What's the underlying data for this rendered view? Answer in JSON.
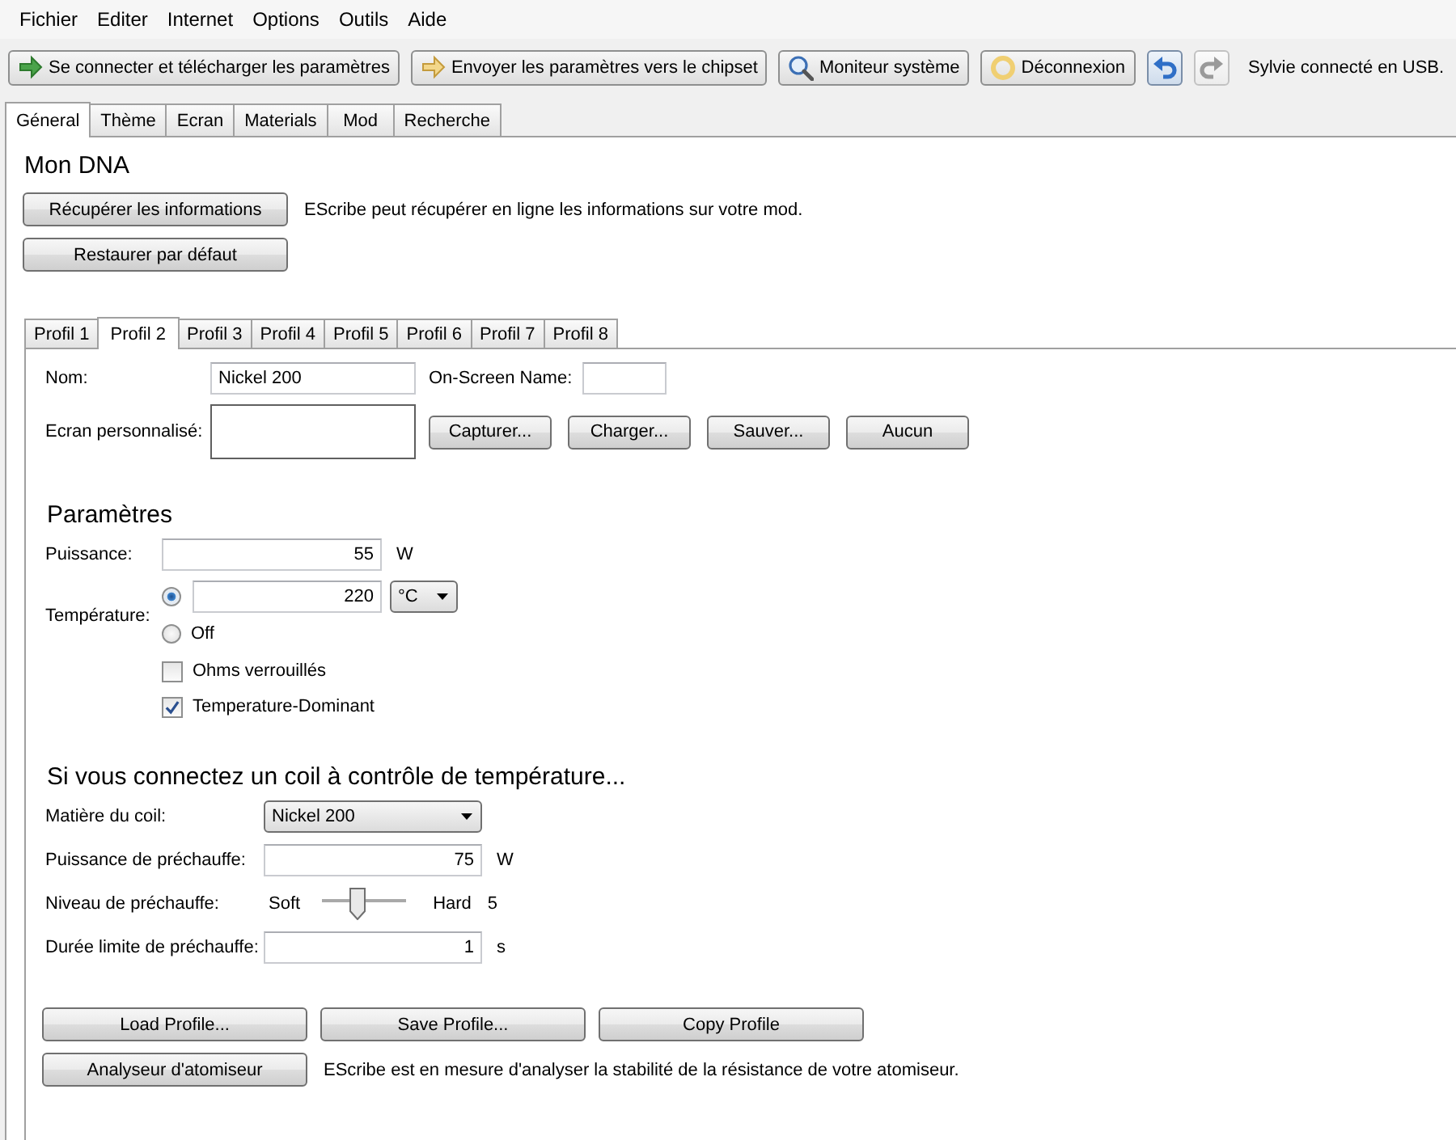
{
  "menu": [
    "Fichier",
    "Editer",
    "Internet",
    "Options",
    "Outils",
    "Aide"
  ],
  "toolbar": {
    "buttons": [
      {
        "kind": "connect",
        "label": "Se connecter et télécharger les paramètres",
        "disabled": false
      },
      {
        "kind": "send",
        "label": "Envoyer les paramètres vers le chipset",
        "disabled": false
      },
      {
        "kind": "monitor",
        "label": "Moniteur système",
        "disabled": false
      },
      {
        "kind": "disconnect",
        "label": "Déconnexion",
        "disabled": false
      },
      {
        "kind": "undo",
        "disabled": false
      },
      {
        "kind": "redo",
        "disabled": true
      }
    ],
    "status": "Sylvie connecté en USB."
  },
  "tabs": [
    {
      "label": "Géneral",
      "selected": true
    },
    {
      "label": "Thème",
      "selected": false
    },
    {
      "label": "Ecran",
      "selected": false
    },
    {
      "label": "Materials",
      "selected": false
    },
    {
      "label": "Mod",
      "selected": false
    },
    {
      "label": "Recherche",
      "selected": false
    }
  ],
  "general": {
    "title": "Mon DNA",
    "actions": [
      {
        "label": "Récupérer les informations",
        "note": "EScribe peut récupérer en ligne les informations sur votre mod."
      },
      {
        "label": "Restaurer par défaut"
      }
    ],
    "profile_tabs": [
      {
        "label": "Profil 1",
        "selected": false
      },
      {
        "label": "Profil 2",
        "selected": true
      },
      {
        "label": "Profil 3",
        "selected": false
      },
      {
        "label": "Profil 4",
        "selected": false
      },
      {
        "label": "Profil 5",
        "selected": false
      },
      {
        "label": "Profil 6",
        "selected": false
      },
      {
        "label": "Profil 7",
        "selected": false
      },
      {
        "label": "Profil 8",
        "selected": false
      }
    ],
    "profile": {
      "name": {
        "label": "Nom:",
        "value": "Nickel 200"
      },
      "onscreen_name": {
        "label": "On-Screen Name:"
      },
      "custom_screen": {
        "label": "Ecran personnalisé:",
        "buttons": [
          "Capturer...",
          "Charger...",
          "Sauver...",
          "Aucun"
        ]
      },
      "parameters": {
        "title": "Paramètres",
        "power": {
          "label": "Puissance:",
          "value": "55",
          "unit": "W"
        },
        "temperature": {
          "label": "Température:",
          "options": [
            {
              "kind": "value",
              "selected": true,
              "value": "220",
              "unit": "°C"
            },
            {
              "kind": "off",
              "selected": false,
              "label": "Off"
            }
          ]
        },
        "checkboxes": [
          {
            "label": "Ohms verrouillés",
            "checked": false
          },
          {
            "label": "Temperature-Dominant",
            "checked": true
          }
        ]
      },
      "coil": {
        "title": "Si vous connectez un coil à contrôle de température...",
        "rows": [
          {
            "kind": "select",
            "label": "Matière du coil:",
            "value": "Nickel 200"
          },
          {
            "kind": "number",
            "label": "Puissance de préchauffe:",
            "value": "75",
            "unit": "W"
          },
          {
            "kind": "slider",
            "label": "Niveau de préchauffe:",
            "min_label": "Soft",
            "max_label": "Hard",
            "level": 0.42,
            "reading": "5"
          },
          {
            "kind": "number",
            "label": "Durée limite de préchauffe:",
            "value": "1",
            "unit": "s"
          }
        ]
      },
      "buttons": [
        "Load Profile...",
        "Save Profile...",
        "Copy Profile"
      ],
      "analyzer": {
        "label": "Analyseur d'atomiseur",
        "note": "EScribe est en mesure d'analyser la stabilité de la résistance de votre atomiseur."
      }
    }
  }
}
